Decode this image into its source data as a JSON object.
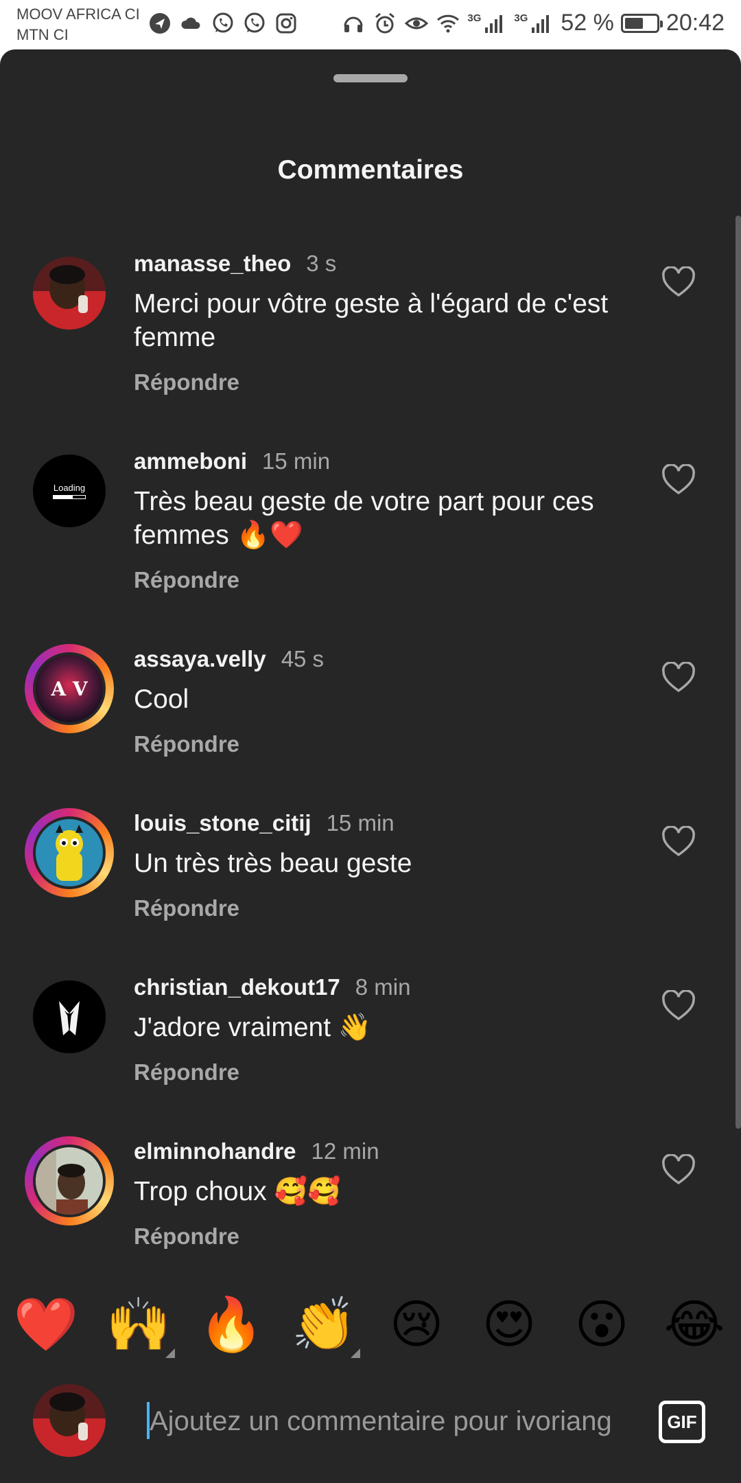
{
  "status_bar": {
    "carrier_1": "MOOV AFRICA CI",
    "carrier_2": "MTN CI",
    "network_1": "3G",
    "network_2": "3G",
    "battery_text": "52 %",
    "battery_level": 0.52,
    "time": "20:42",
    "app_icons": [
      "navigation-icon",
      "cloud-icon",
      "whatsapp-icon",
      "whatsapp-icon",
      "instagram-icon"
    ],
    "system_icons": [
      "headphones-icon",
      "alarm-icon",
      "eye-icon",
      "wifi-icon",
      "signal-icon",
      "signal-icon",
      "battery-icon"
    ]
  },
  "sheet": {
    "title": "Commentaires"
  },
  "comments": [
    {
      "username": "manasse_theo",
      "time": "3 s",
      "text": "Merci pour vôtre geste à l'égard de c'est femme",
      "reply": "Répondre",
      "avatar_ring": false
    },
    {
      "username": "ammeboni",
      "time": "15 min",
      "text": "Très beau geste de votre part pour ces femmes 🔥❤️",
      "reply": "Répondre",
      "avatar_ring": false,
      "avatar_text": "Loading"
    },
    {
      "username": "assaya.velly",
      "time": "45 s",
      "text": "Cool",
      "reply": "Répondre",
      "avatar_ring": true,
      "avatar_text": "A V"
    },
    {
      "username": "louis_stone_citij",
      "time": "15 min",
      "text": "Un très très beau geste",
      "reply": "Répondre",
      "avatar_ring": true
    },
    {
      "username": "christian_dekout17",
      "time": "8 min",
      "text": "J'adore vraiment 👋",
      "reply": "Répondre",
      "avatar_ring": false
    },
    {
      "username": "elminnohandre",
      "time": "12 min",
      "text": "Trop choux 🥰🥰",
      "reply": "Répondre",
      "avatar_ring": true
    }
  ],
  "emoji_bar": [
    "❤️",
    "🙌",
    "🔥",
    "👏",
    "😢",
    "😍",
    "😮",
    "😂"
  ],
  "composer": {
    "placeholder": "Ajoutez un commentaire pour ivoriang",
    "gif_label": "GIF"
  },
  "colors": {
    "sheet_bg": "#262626",
    "text_primary": "#f5f5f5",
    "text_secondary": "#a8a8a8",
    "caret": "#4ab3ff"
  }
}
